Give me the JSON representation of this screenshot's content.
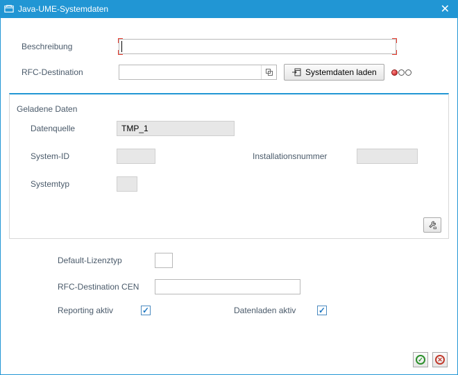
{
  "window": {
    "title": "Java-UME-Systemdaten"
  },
  "top": {
    "beschreibung_label": "Beschreibung",
    "beschreibung_value": "",
    "rfc_label": "RFC-Destination",
    "rfc_value": "",
    "load_button_label": "Systemdaten laden"
  },
  "group": {
    "title": "Geladene Daten",
    "datenquelle_label": "Datenquelle",
    "datenquelle_value": "TMP_1",
    "system_id_label": "System-ID",
    "system_id_value": "",
    "installationsnummer_label": "Installationsnummer",
    "installationsnummer_value": "",
    "systemtyp_label": "Systemtyp",
    "systemtyp_value": ""
  },
  "lower": {
    "default_lizenztyp_label": "Default-Lizenztyp",
    "default_lizenztyp_value": "",
    "rfc_cen_label": "RFC-Destination CEN",
    "rfc_cen_value": "",
    "reporting_aktiv_label": "Reporting aktiv",
    "reporting_aktiv_checked": true,
    "datenladen_aktiv_label": "Datenladen aktiv",
    "datenladen_aktiv_checked": true
  }
}
